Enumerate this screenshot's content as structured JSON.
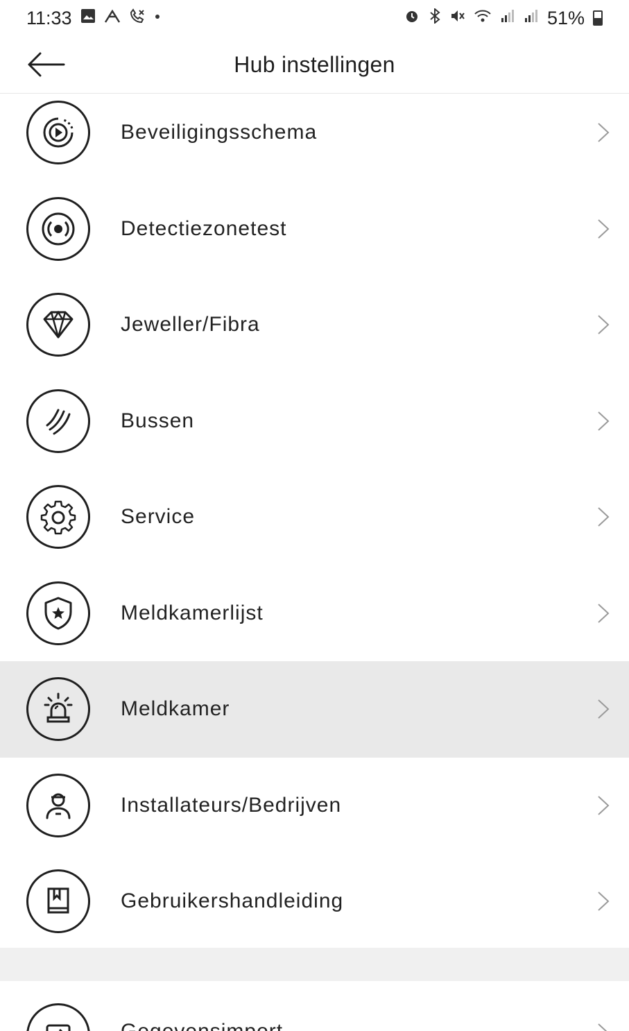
{
  "status_bar": {
    "time": "11:33",
    "battery": "51%",
    "left_icons": [
      "gallery-icon",
      "roaming-icon",
      "missed-call-icon",
      "dot-icon"
    ],
    "right_icons": [
      "alarm-icon",
      "bluetooth-icon",
      "mute-icon",
      "wifi-icon",
      "signal-icon",
      "signal-icon"
    ]
  },
  "app_bar": {
    "title": "Hub instellingen",
    "back_icon": "arrow-left-icon"
  },
  "menu": {
    "items": [
      {
        "label": "Beveiligingsschema",
        "icon": "schedule-play-icon"
      },
      {
        "label": "Detectiezonetest",
        "icon": "detection-zone-icon"
      },
      {
        "label": "Jeweller/Fibra",
        "icon": "diamond-icon"
      },
      {
        "label": "Bussen",
        "icon": "bus-waves-icon"
      },
      {
        "label": "Service",
        "icon": "gear-icon"
      },
      {
        "label": "Meldkamerlijst",
        "icon": "shield-star-icon"
      },
      {
        "label": "Meldkamer",
        "icon": "siren-icon"
      },
      {
        "label": "Installateurs/Bedrijven",
        "icon": "installer-icon"
      },
      {
        "label": "Gebruikershandleiding",
        "icon": "book-icon"
      }
    ],
    "partial_item": {
      "label": "Gegevensimport",
      "icon": "import-icon"
    }
  },
  "colors": {
    "text": "#1f1f1f",
    "highlight": "#e9e9e9",
    "chevron": "#9a9a9a"
  }
}
